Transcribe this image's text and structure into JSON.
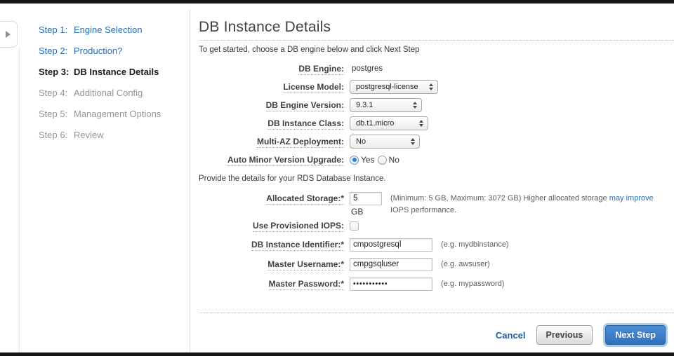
{
  "colors": {
    "accent_blue": "#2a6db5",
    "next_button_blue": "#3b7ec6",
    "current_step_black": "#1c1c1c",
    "upcoming_step_gray": "#969696"
  },
  "sidebar": {
    "collapse_icon": "right-arrow",
    "steps": [
      {
        "prefix": "Step 1:",
        "label": "Engine Selection",
        "state": "done"
      },
      {
        "prefix": "Step 2:",
        "label": "Production?",
        "state": "done"
      },
      {
        "prefix": "Step 3:",
        "label": "DB Instance Details",
        "state": "current"
      },
      {
        "prefix": "Step 4:",
        "label": "Additional Config",
        "state": "upcoming"
      },
      {
        "prefix": "Step 5:",
        "label": "Management Options",
        "state": "upcoming"
      },
      {
        "prefix": "Step 6:",
        "label": "Review",
        "state": "upcoming"
      }
    ]
  },
  "main": {
    "title": "DB Instance Details",
    "intro": "To get started, choose a DB engine below and click Next Step",
    "fields": {
      "db_engine": {
        "label": "DB Engine:",
        "value": "postgres"
      },
      "license_model": {
        "label": "License Model:",
        "value": "postgresql-license"
      },
      "db_engine_version": {
        "label": "DB Engine Version:",
        "value": "9.3.1"
      },
      "db_instance_class": {
        "label": "DB Instance Class:",
        "value": "db.t1.micro"
      },
      "multi_az": {
        "label": "Multi-AZ Deployment:",
        "value": "No"
      },
      "auto_minor_upgrade": {
        "label": "Auto Minor Version Upgrade:",
        "options": [
          "Yes",
          "No"
        ],
        "selected": "Yes"
      }
    },
    "details_intro": "Provide the details for your RDS Database Instance.",
    "storage": {
      "label": "Allocated Storage:*",
      "value": "5",
      "unit": "GB",
      "hint_pre": "(Minimum: 5 GB, Maximum: 3072 GB) Higher allocated storage ",
      "hint_link": "may improve",
      "hint_post": " IOPS performance."
    },
    "provisioned_iops": {
      "label": "Use Provisioned IOPS:",
      "checked": false
    },
    "db_identifier": {
      "label": "DB Instance Identifier:*",
      "value": "cmpostgresql",
      "hint": "(e.g. mydbinstance)"
    },
    "master_username": {
      "label": "Master Username:*",
      "value": "cmpgsqluser",
      "hint": "(e.g. awsuser)"
    },
    "master_password": {
      "label": "Master Password:*",
      "value": "•••••••••••",
      "hint": "(e.g. mypassword)"
    },
    "footer": {
      "cancel": "Cancel",
      "previous": "Previous",
      "next": "Next Step"
    }
  }
}
